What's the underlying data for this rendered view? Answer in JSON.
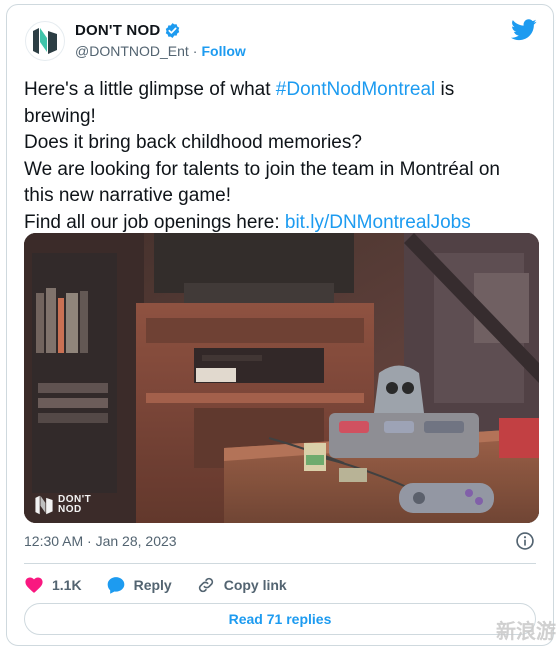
{
  "author": {
    "name": "DON'T NOD",
    "handle": "@DONTNOD_Ent",
    "separator": "·",
    "follow_label": "Follow",
    "verified": true
  },
  "tweet": {
    "lines": [
      {
        "pre": "Here's a little glimpse of what ",
        "link": "#DontNodMontreal",
        "post": " is"
      },
      {
        "pre": "brewing!",
        "link": "",
        "post": ""
      },
      {
        "pre": "Does it bring back childhood memories?",
        "link": "",
        "post": ""
      },
      {
        "pre": "We are looking for talents to join the team in Montréal on",
        "link": "",
        "post": ""
      },
      {
        "pre": "this new narrative game!",
        "link": "",
        "post": ""
      },
      {
        "pre": "Find all our job openings here: ",
        "link": "bit.ly/DNMontrealJobs",
        "post": ""
      }
    ]
  },
  "media": {
    "watermark_line1": "DON'T",
    "watermark_line2": "NOD"
  },
  "meta": {
    "timestamp": "12:30 AM · Jan 28, 2023"
  },
  "actions": {
    "like_count": "1.1K",
    "reply_label": "Reply",
    "copy_link_label": "Copy link"
  },
  "replies": {
    "label": "Read 71 replies"
  },
  "page_watermark": "新浪游",
  "colors": {
    "accent": "#1d9bf0",
    "like": "#f91880",
    "muted": "#536471",
    "border": "#cfd9de"
  }
}
